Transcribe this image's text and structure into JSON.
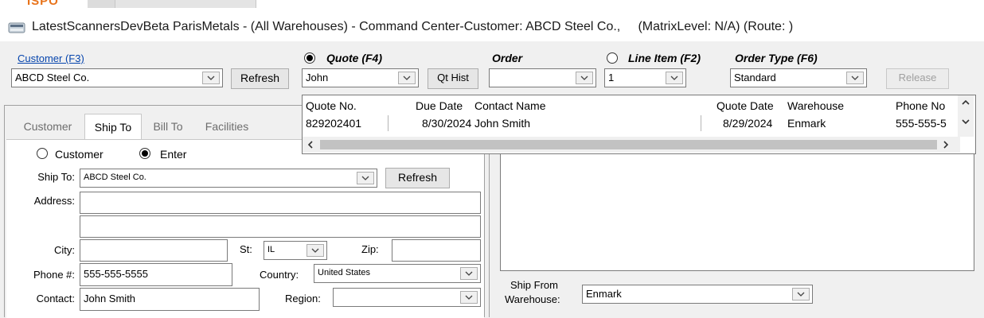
{
  "window": {
    "title": "LatestScannersDevBeta ParisMetals - (All Warehouses) - Command Center-Customer: ABCD Steel Co.,     (MatrixLevel: N/A) (Route: )"
  },
  "header": {
    "customer_link": "Customer (F3)",
    "customer_value": "ABCD Steel Co.",
    "refresh_label": "Refresh",
    "quote_label": "Quote (F4)",
    "quote_value": "John",
    "qt_hist_label": "Qt Hist",
    "order_label": "Order",
    "order_value": "",
    "line_item_label": "Line Item (F2)",
    "line_item_value": "1",
    "order_type_label": "Order Type (F6)",
    "order_type_value": "Standard",
    "release_label": "Release"
  },
  "quote_dropdown": {
    "columns": [
      "Quote No.",
      "Due Date",
      "Contact Name",
      "Quote Date",
      "Warehouse",
      "Phone No"
    ],
    "rows": [
      [
        "829202401",
        "8/30/2024",
        "John Smith",
        "8/29/2024",
        "Enmark",
        "555-555-5"
      ]
    ]
  },
  "tabs": [
    {
      "label": "Customer"
    },
    {
      "label": "Ship To"
    },
    {
      "label": "Bill To"
    },
    {
      "label": "Facilities"
    }
  ],
  "ship_to_form": {
    "radio_customer": "Customer",
    "radio_enter": "Enter",
    "ship_to_label": "Ship To:",
    "ship_to_value": "ABCD Steel Co.",
    "refresh_label": "Refresh",
    "address_label": "Address:",
    "address_line1": "",
    "address_line2": "",
    "city_label": "City:",
    "city_value": "",
    "state_label": "St:",
    "state_value": "IL",
    "zip_label": "Zip:",
    "zip_value": "",
    "phone_label": "Phone #:",
    "phone_value": "555-555-5555",
    "country_label": "Country:",
    "country_value": "United States",
    "contact_label": "Contact:",
    "contact_value": "John Smith",
    "region_label": "Region:",
    "region_value": ""
  },
  "ship_from": {
    "label_line1": "Ship From",
    "label_line2": "Warehouse:",
    "value": "Enmark"
  },
  "icons": {
    "app": "app-window-icon",
    "dropdown": "chevron-down-icon"
  }
}
